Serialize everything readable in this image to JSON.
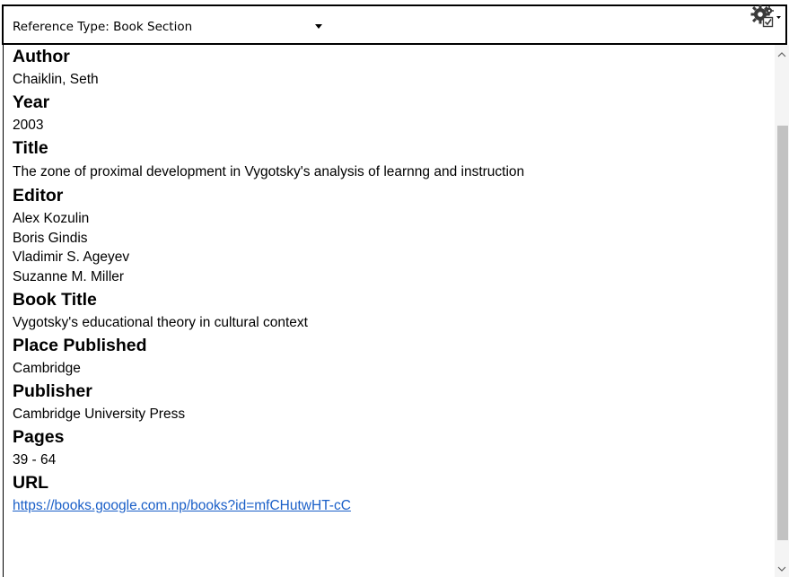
{
  "toolbar": {
    "reference_type_label": "Reference Type:  Book Section",
    "dropdown_icon": "caret-down-icon",
    "settings_icon": "gear-check-icon"
  },
  "fields": {
    "author": {
      "label": "Author",
      "values": [
        "Chaiklin, Seth"
      ]
    },
    "year": {
      "label": "Year",
      "value": "2003"
    },
    "title": {
      "label": "Title",
      "value": "The zone of proximal development in Vygotsky's analysis of learnng and instruction"
    },
    "editor": {
      "label": "Editor",
      "values": [
        "Alex Kozulin",
        "Boris Gindis",
        "Vladimir S. Ageyev",
        "Suzanne M. Miller"
      ]
    },
    "book_title": {
      "label": "Book Title",
      "value": "Vygotsky's educational theory in cultural context"
    },
    "place_published": {
      "label": "Place Published",
      "value": "Cambridge"
    },
    "publisher": {
      "label": "Publisher",
      "value": "Cambridge University Press"
    },
    "pages": {
      "label": "Pages",
      "value": "39 - 64"
    },
    "url": {
      "label": "URL",
      "value": "https://books.google.com.np/books?id=mfCHutwHT-cC"
    }
  },
  "colors": {
    "link": "#1a5fc8",
    "scrollbar_track": "#f4f4f4",
    "scrollbar_thumb": "#c2c2c2"
  }
}
